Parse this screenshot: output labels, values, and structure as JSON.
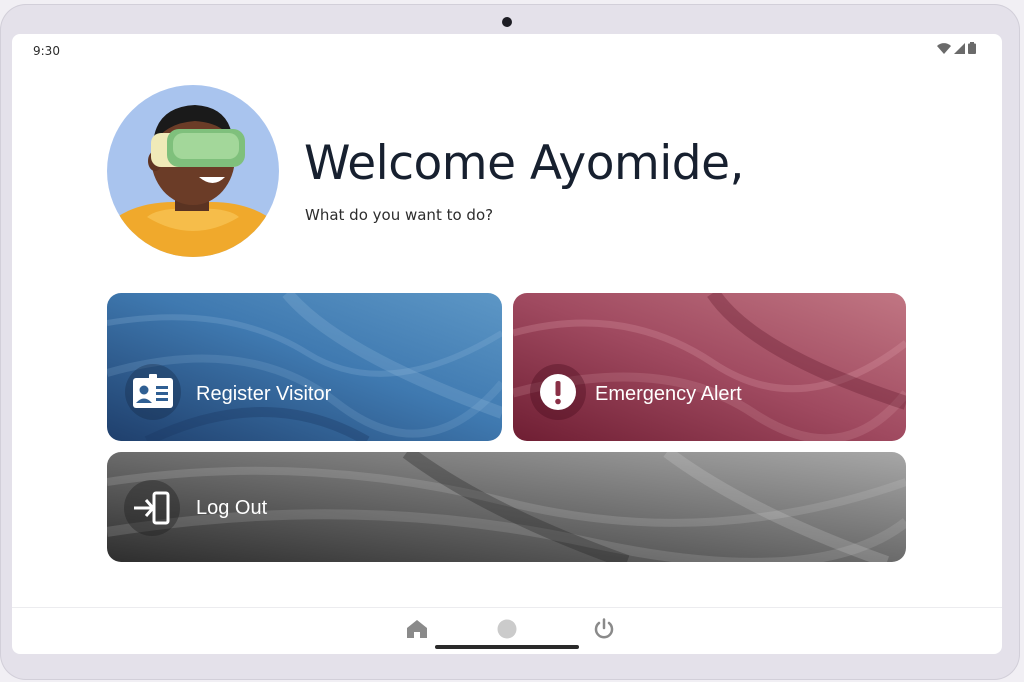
{
  "status_bar": {
    "time": "9:30"
  },
  "header": {
    "greeting": "Welcome Ayomide,",
    "prompt": "What do you want to do?",
    "avatar_icon": "vr-headset-avatar"
  },
  "actions": [
    {
      "label": "Register Visitor",
      "icon": "id-card-icon",
      "color": "#2f5f93"
    },
    {
      "label": "Emergency Alert",
      "icon": "exclamation-icon",
      "color": "#8a3046"
    },
    {
      "label": "Log Out",
      "icon": "logout-icon",
      "color": "#5b5b5b"
    }
  ],
  "nav": {
    "items": [
      "home-icon",
      "circle-icon",
      "power-icon"
    ]
  }
}
